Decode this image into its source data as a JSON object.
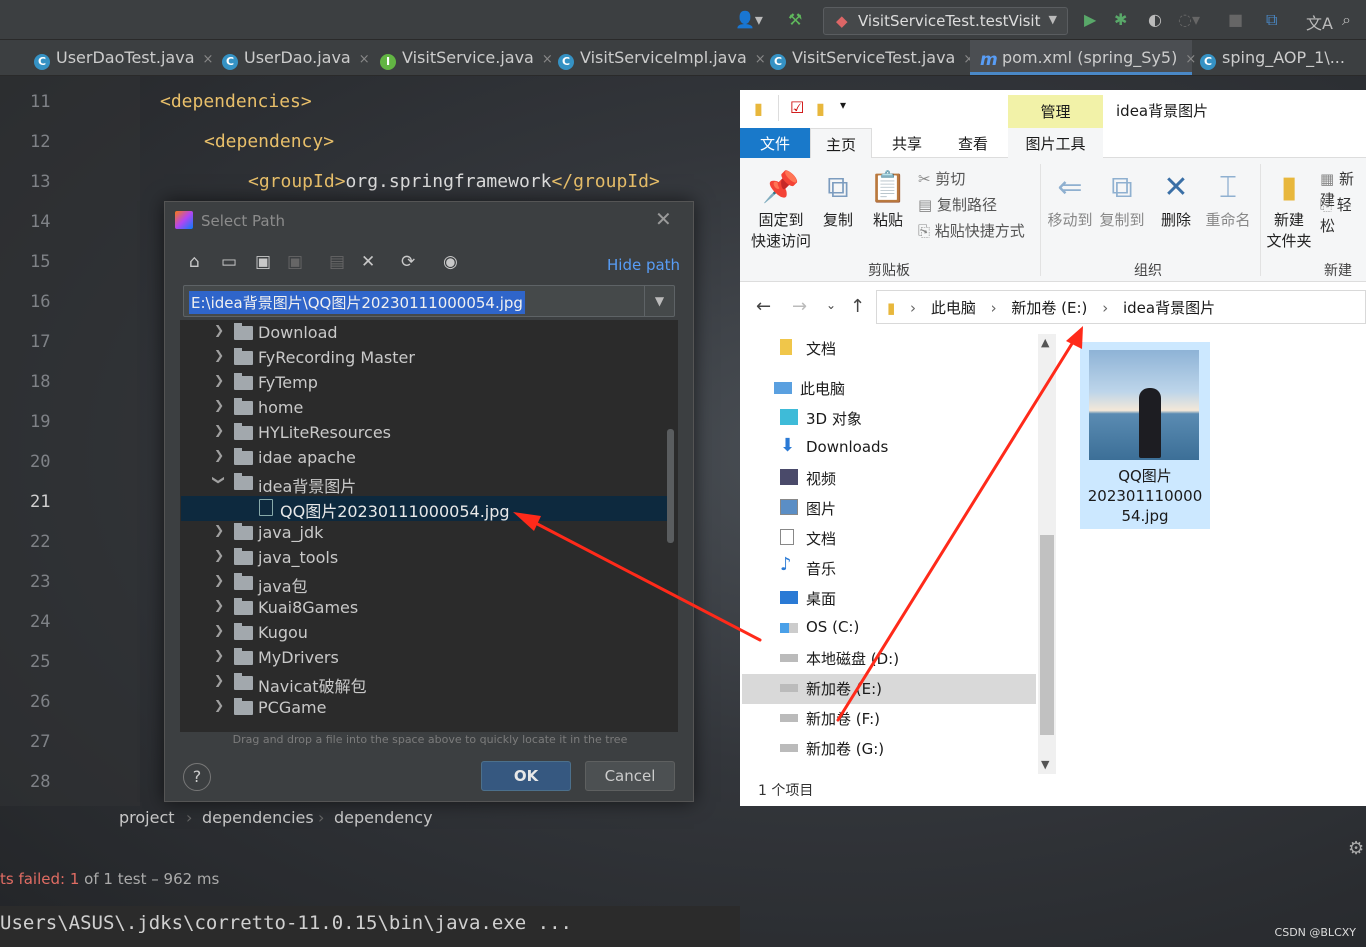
{
  "toolbar": {
    "run_config": "VisitServiceTest.testVisit"
  },
  "tabs": [
    {
      "label": "UserDaoTest.java",
      "icon": "C"
    },
    {
      "label": "UserDao.java",
      "icon": "C"
    },
    {
      "label": "VisitService.java",
      "icon": "I"
    },
    {
      "label": "VisitServiceImpl.java",
      "icon": "C"
    },
    {
      "label": "VisitServiceTest.java",
      "icon": "C"
    },
    {
      "label": "pom.xml (spring_Sy5)",
      "icon": "m"
    },
    {
      "label": "sping_AOP_1\\..."
    }
  ],
  "editor": {
    "lines": [
      "11",
      "12",
      "13",
      "14",
      "15",
      "16",
      "17",
      "18",
      "19",
      "20",
      "21",
      "22",
      "23",
      "24",
      "25",
      "26",
      "27",
      "28"
    ],
    "code": {
      "l11": "<dependencies>",
      "l12": "<dependency>",
      "l13_open": "<groupId>",
      "l13_text": "org.springframework",
      "l13_close": "</groupId>"
    }
  },
  "breadcrumbs": [
    "project",
    "dependencies",
    "dependency"
  ],
  "test_status": {
    "prefix": "ts failed: ",
    "count": "1",
    "suffix": " of 1 test – 962 ms"
  },
  "console": "Users\\ASUS\\.jdks\\corretto-11.0.15\\bin\\java.exe ...",
  "dialog": {
    "title": "Select Path",
    "hide_path": "Hide path",
    "path": "E:\\idea背景图片\\QQ图片20230111000054.jpg",
    "tree": [
      {
        "name": "Download",
        "expanded": false
      },
      {
        "name": "FyRecording Master",
        "expanded": false
      },
      {
        "name": "FyTemp",
        "expanded": false
      },
      {
        "name": "home",
        "expanded": false
      },
      {
        "name": "HYLiteResources",
        "expanded": false
      },
      {
        "name": "idae apache",
        "expanded": false
      },
      {
        "name": "idea背景图片",
        "expanded": true
      },
      {
        "name": "QQ图片20230111000054.jpg",
        "file": true
      },
      {
        "name": "java_jdk",
        "expanded": false
      },
      {
        "name": "java_tools",
        "expanded": false
      },
      {
        "name": "java包",
        "expanded": false
      },
      {
        "name": "Kuai8Games",
        "expanded": false
      },
      {
        "name": "Kugou",
        "expanded": false
      },
      {
        "name": "MyDrivers",
        "expanded": false
      },
      {
        "name": "Navicat破解包",
        "expanded": false
      },
      {
        "name": "PCGame",
        "expanded": false
      }
    ],
    "drag_hint": "Drag and drop a file into the space above to quickly locate it in the tree",
    "help": "?",
    "ok": "OK",
    "cancel": "Cancel"
  },
  "explorer": {
    "title": "idea背景图片",
    "manage": "管理",
    "tabs": {
      "file": "文件",
      "home": "主页",
      "share": "共享",
      "view": "查看",
      "picture_tools": "图片工具"
    },
    "ribbon": {
      "pin_l1": "固定到",
      "pin_l2": "快速访问",
      "copy": "复制",
      "paste": "粘贴",
      "cut": "剪切",
      "copy_path": "复制路径",
      "paste_shortcut": "粘贴快捷方式",
      "clipboard": "剪贴板",
      "move_to": "移动到",
      "copy_to": "复制到",
      "delete": "删除",
      "rename": "重命名",
      "organize": "组织",
      "new_folder_l1": "新建",
      "new_folder_l2": "文件夹",
      "new_item": "新建",
      "easy_access": "轻松",
      "new_group": "新建"
    },
    "address": [
      "此电脑",
      "新加卷 (E:)",
      "idea背景图片"
    ],
    "nav": [
      {
        "label": "文档",
        "icon": "folder-icon"
      },
      {
        "label": "此电脑",
        "icon": "pc-icon"
      },
      {
        "label": "3D 对象",
        "icon": "3d-icon"
      },
      {
        "label": "Downloads",
        "icon": "download-icon"
      },
      {
        "label": "视频",
        "icon": "video-icon"
      },
      {
        "label": "图片",
        "icon": "picture-icon"
      },
      {
        "label": "文档",
        "icon": "document-icon"
      },
      {
        "label": "音乐",
        "icon": "music-icon"
      },
      {
        "label": "桌面",
        "icon": "desktop-icon"
      },
      {
        "label": "OS (C:)",
        "icon": "drive-icon"
      },
      {
        "label": "本地磁盘 (D:)",
        "icon": "drive-icon"
      },
      {
        "label": "新加卷 (E:)",
        "icon": "drive-icon",
        "selected": true
      },
      {
        "label": "新加卷 (F:)",
        "icon": "drive-icon"
      },
      {
        "label": "新加卷 (G:)",
        "icon": "drive-icon"
      }
    ],
    "file": {
      "name_l1": "QQ图片",
      "name_l2": "202301110000",
      "name_l3": "54.jpg"
    },
    "status": "1 个项目"
  },
  "watermark": "CSDN @BLCXY",
  "colors": {
    "accent": "#1979ca",
    "annotation_arrow": "#ff2a1a",
    "ide_selection": "#2f65ca"
  }
}
